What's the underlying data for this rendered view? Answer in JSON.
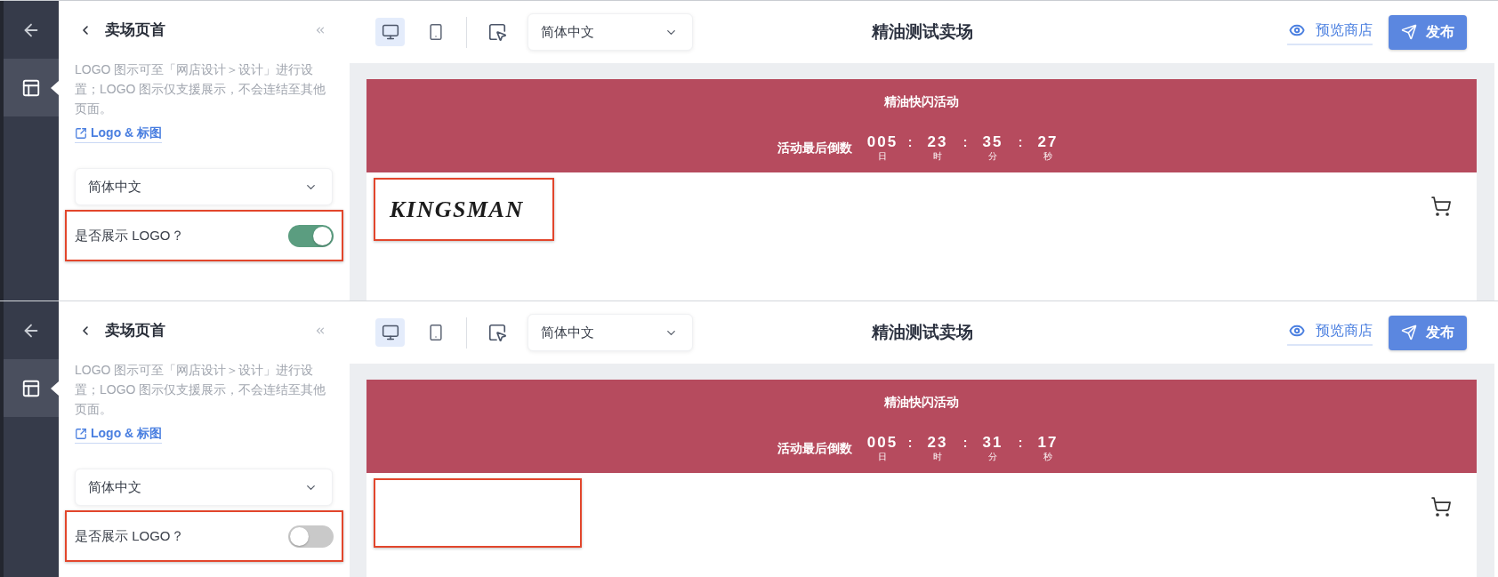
{
  "panels": [
    {
      "rail": {
        "items": [
          {
            "kind": "back",
            "selected": false
          },
          {
            "kind": "layout",
            "selected": true
          }
        ]
      },
      "sidebar": {
        "title": "卖场页首",
        "description": "LOGO 图示可至「网店设计＞设计」进行设置；LOGO 图示仅支援展示，不会连结至其他页面。",
        "link": "Logo & 标图",
        "language_select": {
          "value": "简体中文"
        },
        "show_logo": {
          "label": "是否展示 LOGO？",
          "on": true
        }
      },
      "toolbar": {
        "devices": [
          {
            "kind": "desktop",
            "selected": true
          },
          {
            "kind": "mobile",
            "selected": false
          }
        ],
        "language_select": {
          "value": "简体中文"
        },
        "title": "精油测试卖场",
        "preview_link": "预览商店",
        "publish_button": "发布"
      },
      "preview": {
        "banner_title": "精油快闪活动",
        "countdown": {
          "label": "活动最后倒数",
          "units": [
            {
              "value": "005",
              "unit": "日"
            },
            {
              "separator": ":",
              "value": "23",
              "unit": "时"
            },
            {
              "separator": ":",
              "value": "35",
              "unit": "分"
            },
            {
              "separator": ":",
              "value": "27",
              "unit": "秒"
            }
          ]
        },
        "logo": {
          "text": "KINGSMAN"
        }
      }
    },
    {
      "rail": {
        "items": [
          {
            "kind": "back",
            "selected": false
          },
          {
            "kind": "layout",
            "selected": true
          }
        ]
      },
      "sidebar": {
        "title": "卖场页首",
        "description": "LOGO 图示可至「网店设计＞设计」进行设置；LOGO 图示仅支援展示，不会连结至其他页面。",
        "link": "Logo & 标图",
        "language_select": {
          "value": "简体中文"
        },
        "show_logo": {
          "label": "是否展示 LOGO？",
          "on": false
        }
      },
      "toolbar": {
        "devices": [
          {
            "kind": "desktop",
            "selected": true
          },
          {
            "kind": "mobile",
            "selected": false
          }
        ],
        "language_select": {
          "value": "简体中文"
        },
        "title": "精油测试卖场",
        "preview_link": "预览商店",
        "publish_button": "发布"
      },
      "preview": {
        "banner_title": "精油快闪活动",
        "countdown": {
          "label": "活动最后倒数",
          "units": [
            {
              "value": "005",
              "unit": "日"
            },
            {
              "separator": ":",
              "value": "23",
              "unit": "时"
            },
            {
              "separator": ":",
              "value": "31",
              "unit": "分"
            },
            {
              "separator": ":",
              "value": "17",
              "unit": "秒"
            }
          ]
        }
      }
    }
  ]
}
